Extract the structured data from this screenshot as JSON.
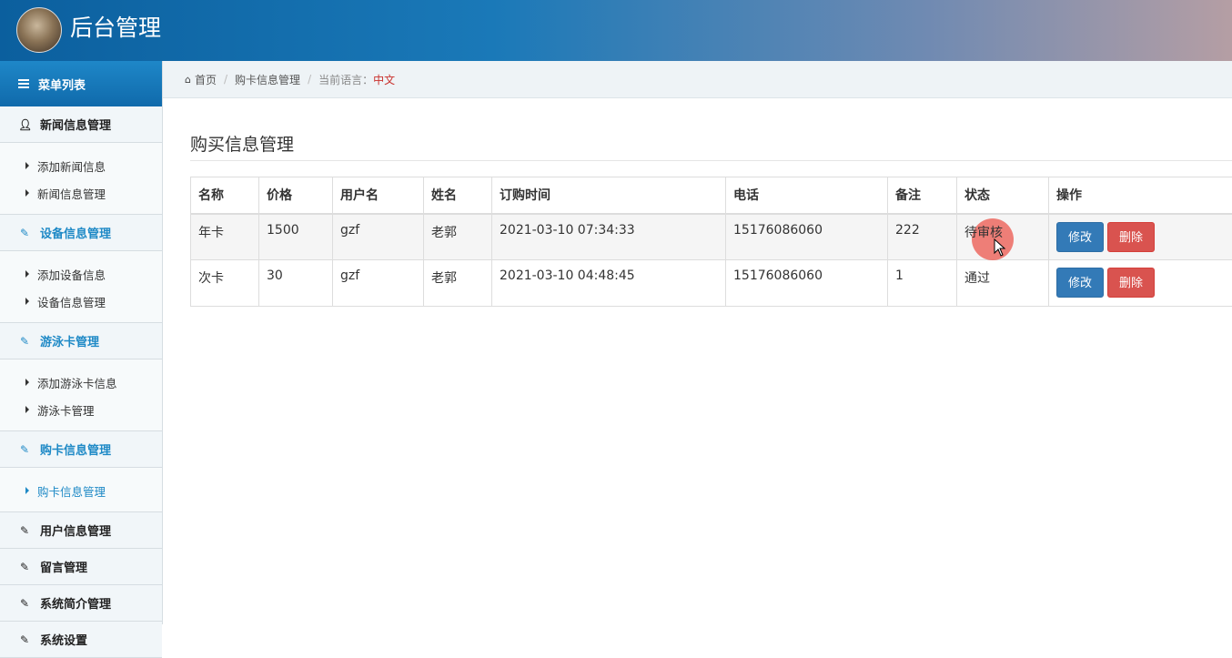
{
  "header": {
    "title": "后台管理"
  },
  "sidebar": {
    "menu_title": "菜单列表",
    "groups": [
      {
        "label": "新闻信息管理",
        "items": [
          "添加新闻信息",
          "新闻信息管理"
        ]
      },
      {
        "label": "设备信息管理",
        "items": [
          "添加设备信息",
          "设备信息管理"
        ]
      },
      {
        "label": "游泳卡管理",
        "items": [
          "添加游泳卡信息",
          "游泳卡管理"
        ]
      },
      {
        "label": "购卡信息管理",
        "items": [
          "购卡信息管理"
        ]
      },
      {
        "label": "用户信息管理"
      },
      {
        "label": "留言管理"
      },
      {
        "label": "系统简介管理"
      },
      {
        "label": "系统设置"
      }
    ]
  },
  "breadcrumb": {
    "home": "首页",
    "current": "购卡信息管理",
    "lang_label": "当前语言：",
    "lang_value": "中文"
  },
  "main": {
    "title": "购买信息管理",
    "columns": [
      "名称",
      "价格",
      "用户名",
      "姓名",
      "订购时间",
      "电话",
      "备注",
      "状态",
      "操作"
    ],
    "rows": [
      {
        "name": "年卡",
        "price": "1500",
        "username": "gzf",
        "realname": "老郭",
        "time": "2021-03-10 07:34:33",
        "phone": "15176086060",
        "note": "222",
        "status": "待审核",
        "edit": "修改",
        "delete": "删除"
      },
      {
        "name": "次卡",
        "price": "30",
        "username": "gzf",
        "realname": "老郭",
        "time": "2021-03-10 04:48:45",
        "phone": "15176086060",
        "note": "1",
        "status": "通过",
        "edit": "修改",
        "delete": "删除"
      }
    ]
  },
  "colors": {
    "accent": "#1e89c6",
    "edit_button": "#337ab7",
    "delete_button": "#d9534f",
    "language": "#c9302c"
  }
}
